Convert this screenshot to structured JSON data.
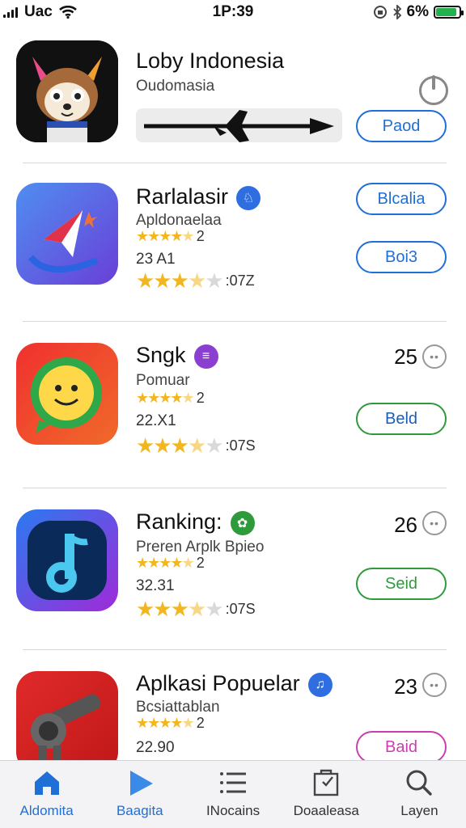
{
  "status_bar": {
    "carrier": "Uac",
    "time": "1P:39",
    "battery": "6%",
    "battery_level": 0.9
  },
  "featured": {
    "title": "Loby Indonesia",
    "subtitle": "Oudomasia",
    "button": "Paod",
    "icon": "cartoon-character-icon"
  },
  "apps": [
    {
      "title": "Rarlalasir",
      "badge_icon": "person-badge-icon",
      "badge_color": "#2f6ee0",
      "subtitle": "Apldonaelaa",
      "small_rating": "2",
      "meta": "23 A1",
      "big_rating": ":07Z",
      "primary_button": "Blcalia",
      "secondary_button": "Boi3",
      "icon": "paper-plane-icon",
      "small_stars": 4.5,
      "big_stars": 3.5
    },
    {
      "title": "Sngk",
      "badge_icon": "letter-badge-icon",
      "badge_color": "#8a3fd0",
      "subtitle": "Pomuar",
      "small_rating": "2",
      "meta": "22.X1",
      "big_rating": ":07S",
      "rank": "25",
      "button": "Beld",
      "icon": "chat-smiley-icon",
      "small_stars": 4.5,
      "big_stars": 3.5
    },
    {
      "title": "Ranking:",
      "badge_icon": "leaf-badge-icon",
      "badge_color": "#2f9a3c",
      "subtitle": "Preren Arplk Bpieo",
      "small_rating": "2",
      "meta": "32.31",
      "big_rating": ":07S",
      "rank": "26",
      "button": "Seid",
      "icon": "music-note-icon",
      "small_stars": 4.5,
      "big_stars": 3.5
    },
    {
      "title": "Aplkasi Popuelar",
      "badge_icon": "music-badge-icon",
      "badge_color": "#2f6ee0",
      "subtitle": "Bcsiattablan",
      "small_rating": "2",
      "meta": "22.90",
      "rank": "23",
      "button": "Baid",
      "icon": "robot-cannon-icon",
      "small_stars": 4.5
    }
  ],
  "tabs": [
    {
      "label": "Aldomita",
      "icon": "home-icon",
      "active": true
    },
    {
      "label": "Baagita",
      "icon": "play-icon",
      "active": true
    },
    {
      "label": "INocains",
      "icon": "list-icon",
      "active": false
    },
    {
      "label": "Doaaleasa",
      "icon": "clipboard-icon",
      "active": false
    },
    {
      "label": "Layen",
      "icon": "search-icon",
      "active": false
    }
  ]
}
